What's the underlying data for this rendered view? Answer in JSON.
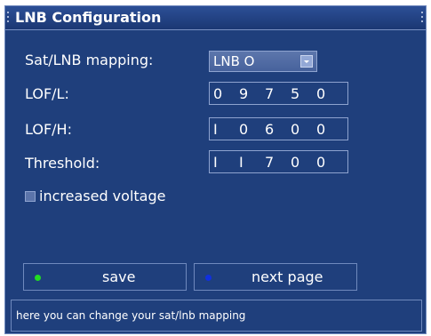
{
  "window": {
    "title": "LNB Configuration"
  },
  "fields": {
    "mapping_label": "Sat/LNB mapping:",
    "mapping_value": "LNB O",
    "lof_l_label": "LOF/L:",
    "lof_l_digits": [
      "0",
      "9",
      "7",
      "5",
      "0"
    ],
    "lof_h_label": "LOF/H:",
    "lof_h_digits": [
      "I",
      "0",
      "6",
      "0",
      "0"
    ],
    "threshold_label": "Threshold:",
    "threshold_digits": [
      "I",
      "I",
      "7",
      "0",
      "0"
    ],
    "increased_voltage_label": "increased voltage",
    "increased_voltage_checked": false
  },
  "buttons": {
    "save_label": "save",
    "save_color": "#22dd22",
    "next_label": "next page",
    "next_color": "#1030e0"
  },
  "status": {
    "help_text": "here you can change your sat/lnb mapping"
  },
  "icons": {
    "dropdown": "chevron-down-icon",
    "title_grip": "grip-icon"
  }
}
